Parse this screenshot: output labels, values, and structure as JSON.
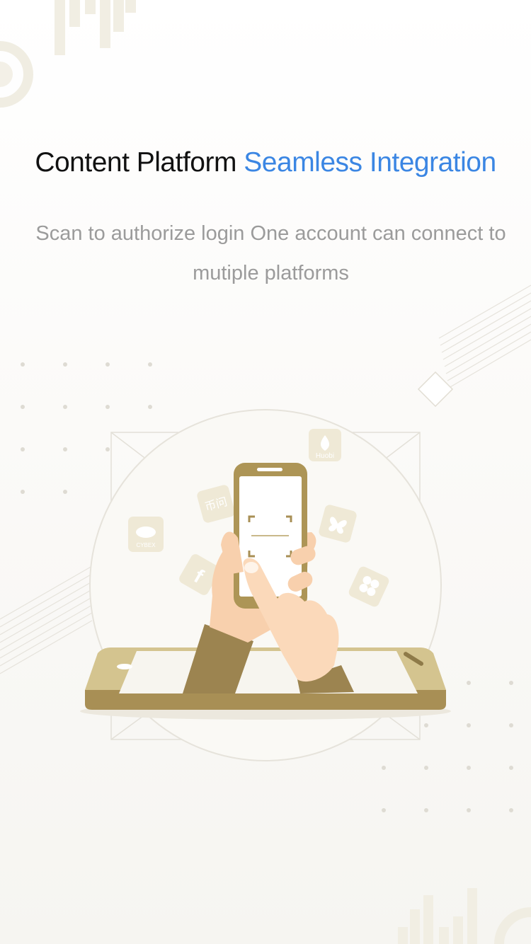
{
  "header": {
    "title_main": "Content Platform",
    "title_accent": "Seamless Integration",
    "subtitle": "Scan to authorize login One account can connect to mutiple platforms"
  },
  "platform_icons": {
    "huobi": "Huobi",
    "biwen": "币问",
    "cybex": "CYBEX",
    "facebook": "f",
    "butterfly": "butterfly-icon",
    "okex": "OKEx"
  },
  "colors": {
    "accent_blue": "#3b86e3",
    "gold": "#a89258",
    "gold_light": "#d4c48f",
    "cream": "#f2efe4",
    "text_gray": "#9b9b9b"
  }
}
